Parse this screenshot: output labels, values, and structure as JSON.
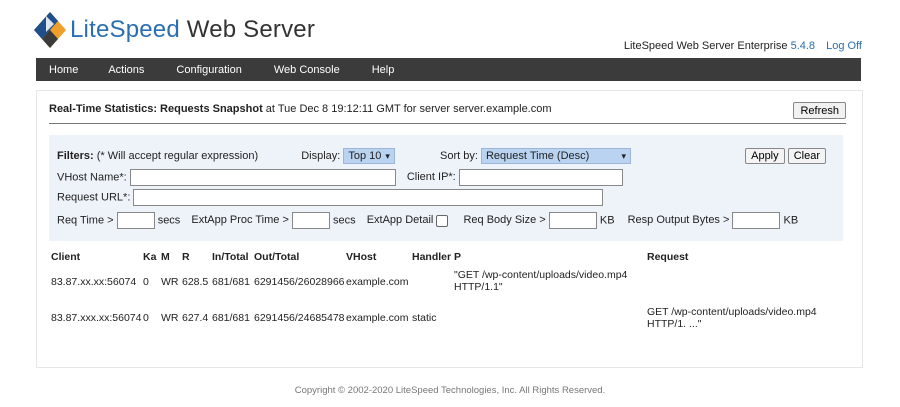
{
  "header": {
    "brand_lite": "LiteSpeed",
    "brand_rest": " Web Server",
    "product": "LiteSpeed Web Server Enterprise",
    "version": "5.4.8",
    "logoff": "Log Off"
  },
  "nav": [
    "Home",
    "Actions",
    "Configuration",
    "Web Console",
    "Help"
  ],
  "page": {
    "title": "Real-Time Statistics: Requests Snapshot",
    "subtitle": " at Tue Dec 8 19:12:11 GMT for server server.example.com",
    "refresh": "Refresh"
  },
  "filters": {
    "label": "Filters:",
    "note": "(* Will accept regular expression)",
    "display_label": "Display:",
    "display_value": "Top 10",
    "sort_label": "Sort by:",
    "sort_value": "Request Time (Desc)",
    "apply": "Apply",
    "clear": "Clear",
    "vhost_label": "VHost Name*:",
    "clientip_label": "Client IP*:",
    "url_label": "Request URL*:",
    "reqtime_label": "Req Time >",
    "secs1": "secs",
    "extapp_label": "ExtApp Proc Time >",
    "secs2": "secs",
    "extapp_detail": "ExtApp Detail",
    "body_label": "Req Body Size >",
    "kb1": "KB",
    "resp_label": "Resp Output Bytes >",
    "kb2": "KB"
  },
  "table": {
    "columns": [
      "Client",
      "Ka",
      "M",
      "R",
      "In/Total",
      "Out/Total",
      "VHost",
      "Handler",
      "P",
      "Request"
    ],
    "rows": [
      {
        "client": "83.87.xx.xx:56074",
        "ka": "0",
        "m": "WR",
        "r": "628.5",
        "in": "681/681",
        "out": "6291456/26028966",
        "vhost": "example.com",
        "handler": "",
        "p1": "\"GET /wp-content/uploads/video.mp4",
        "p2": "HTTP/1.1\"",
        "req1": "",
        "req2": ""
      },
      {
        "client": "83.87.xxx.xx:56074",
        "ka": "0",
        "m": "WR",
        "r": "627.4",
        "in": "681/681",
        "out": "6291456/24685478",
        "vhost": "example.com",
        "handler": "static",
        "p1": "",
        "p2": "",
        "req1": "GET /wp-content/uploads/video.mp4",
        "req2": "HTTP/1. ...\""
      }
    ]
  },
  "footer": "Copyright © 2002-2020 LiteSpeed Technologies, Inc. All Rights Reserved.",
  "colors": {
    "accent": "#2b6fb0",
    "navbar": "#3b3b3b",
    "filter_bg": "#eef3fa",
    "select_bg": "#b9d3f0"
  }
}
